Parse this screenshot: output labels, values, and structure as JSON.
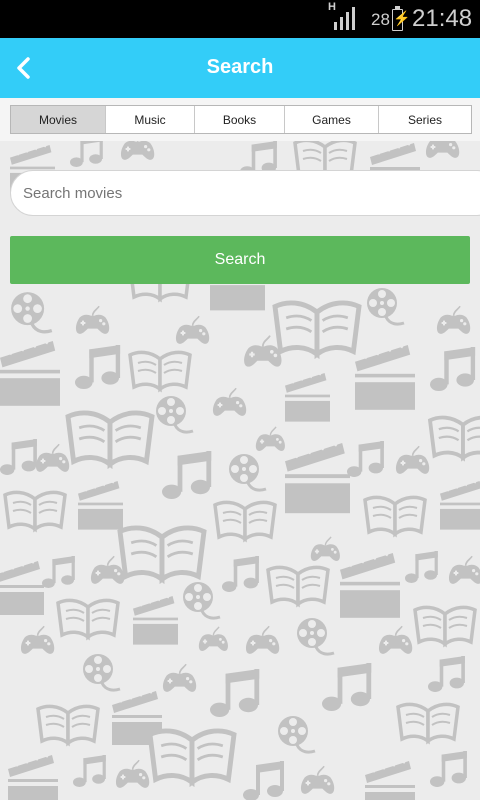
{
  "status_bar": {
    "network": "H",
    "battery": "28",
    "time": "21:48"
  },
  "header": {
    "title": "Search",
    "back_icon": "chevron-left-icon"
  },
  "tabs": [
    {
      "label": "Movies",
      "active": true
    },
    {
      "label": "Music",
      "active": false
    },
    {
      "label": "Books",
      "active": false
    },
    {
      "label": "Games",
      "active": false
    },
    {
      "label": "Series",
      "active": false
    }
  ],
  "search": {
    "placeholder": "Search movies",
    "button_label": "Search"
  },
  "colors": {
    "accent": "#33cdf8",
    "button": "#5cb85c",
    "pattern": "#c2c2c2",
    "background": "#ececec"
  },
  "background_pattern_icons": [
    "clapperboard-icon",
    "music-note-icon",
    "open-book-icon",
    "gamepad-icon",
    "film-reel-icon"
  ]
}
